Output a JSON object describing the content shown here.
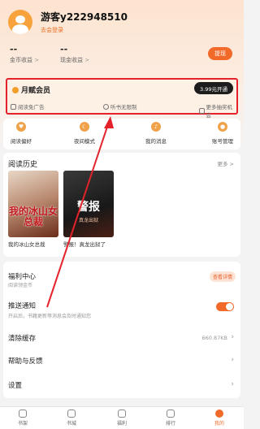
{
  "profile": {
    "username": "游客y222948510",
    "login_hint": "去会登录"
  },
  "assets": {
    "coins": {
      "value": "--",
      "label": "金币收益",
      "arrow": ">"
    },
    "cash": {
      "value": "--",
      "label": "现金收益",
      "arrow": ">"
    },
    "withdraw_label": "提现"
  },
  "vip": {
    "title": "月赋会员",
    "open_label": "3.99元开通",
    "perks": [
      "阅读免广告",
      "听书无限制",
      "更多抽奖机会"
    ]
  },
  "shortcuts": [
    "阅读偏好",
    "夜间模式",
    "我的消息",
    "账号管理"
  ],
  "history": {
    "title": "阅读历史",
    "more": "更多 >",
    "books": [
      {
        "title": "我的冰山女总裁",
        "cover_text": "我的冰山女总裁"
      },
      {
        "title": "警报！真龙出狱了",
        "cover_text": "警报",
        "cover_sub": "真龙出狱"
      }
    ]
  },
  "welfare": {
    "title": "福利中心",
    "sub": "阅读领金币",
    "detail_label": "查看详情",
    "push_title": "推送通知",
    "push_sub": "开启后，书籍更新等消息会及时通知您",
    "cache_title": "清除缓存",
    "cache_value": "660.87KB",
    "help_title": "帮助与反馈",
    "settings_title": "设置"
  },
  "tabs": [
    {
      "label": "书架"
    },
    {
      "label": "书城"
    },
    {
      "label": "福利"
    },
    {
      "label": "排行"
    },
    {
      "label": "我的"
    }
  ],
  "colors": {
    "accent": "#f26a2a",
    "highlight": "#e5222b"
  }
}
